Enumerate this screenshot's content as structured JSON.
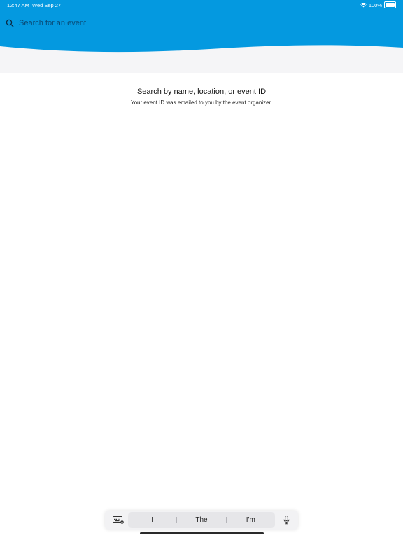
{
  "status_bar": {
    "time": "12:47 AM",
    "date": "Wed Sep 27",
    "dots": "···",
    "battery_percent": "100%",
    "battery_level": 1.0
  },
  "search": {
    "placeholder": "Search for an event",
    "value": ""
  },
  "empty_state": {
    "title": "Search by name, location, or event ID",
    "subtitle": "Your event ID was emailed to you by the event organizer."
  },
  "keyboard_shortcut_bar": {
    "suggestions": [
      "I",
      "The",
      "I'm"
    ]
  },
  "theme": {
    "header_color": "#0499e0",
    "header_band_color": "#f5f5f7",
    "background": "#ffffff"
  },
  "icons": {
    "search": "search-icon",
    "wifi": "wifi-icon",
    "battery": "battery-icon",
    "keyboard": "keyboard-icon",
    "microphone": "microphone-icon"
  }
}
